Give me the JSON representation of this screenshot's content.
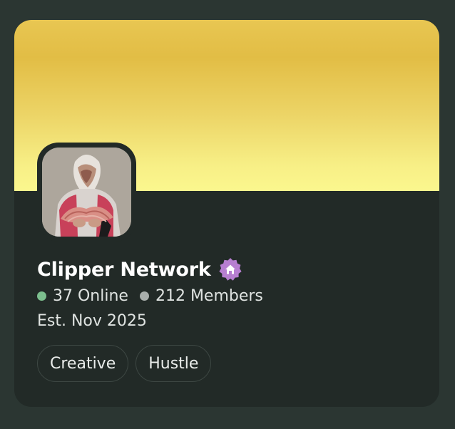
{
  "server": {
    "name": "Clipper Network",
    "online_count": "37 Online",
    "member_count": "212 Members",
    "established": "Est. Nov 2025",
    "badge_icon": "home-icon",
    "tags": [
      "Creative",
      "Hustle"
    ]
  },
  "colors": {
    "banner_top": "#e2bd45",
    "banner_bottom": "#fbf78e",
    "card_background": "#222a27",
    "page_background": "#2b3632",
    "online_dot": "#7cbf8e",
    "members_dot": "#a9afac",
    "badge": "#b77fd0"
  }
}
